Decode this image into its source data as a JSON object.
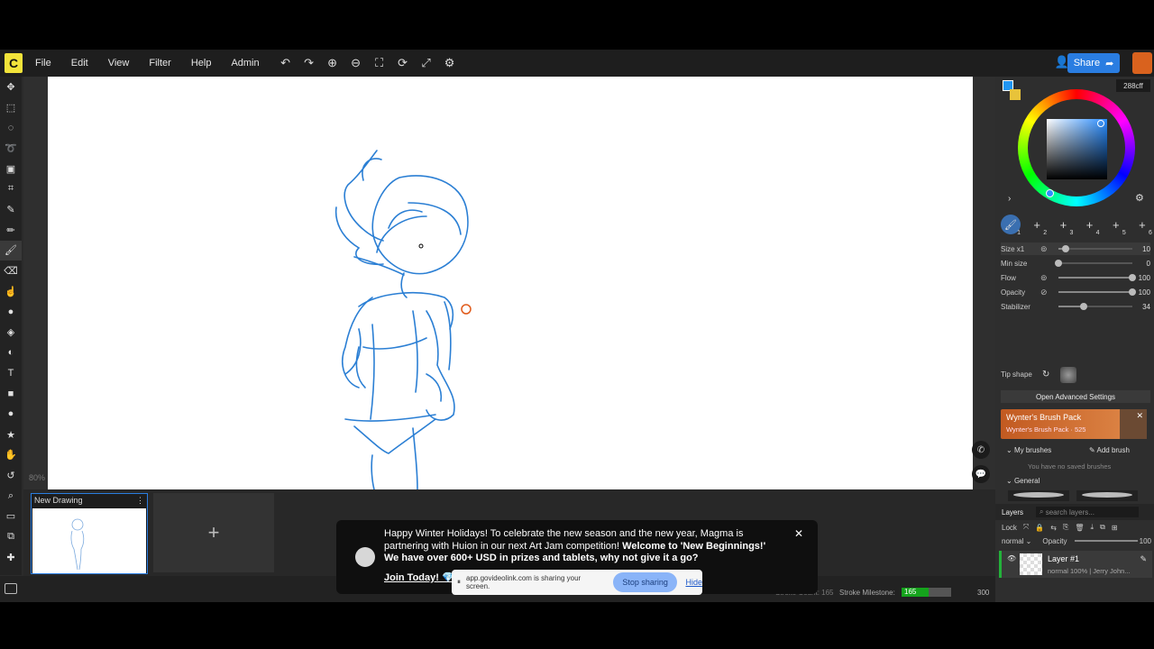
{
  "app": {
    "logo": "C"
  },
  "menu": [
    "File",
    "Edit",
    "View",
    "Filter",
    "Help",
    "Admin"
  ],
  "toolbar_icons": [
    "undo-icon",
    "redo-icon",
    "zoom-in-icon",
    "zoom-out-icon",
    "fit-icon",
    "rotate-icon",
    "fullscreen-icon",
    "settings-icon"
  ],
  "share": {
    "label": "Share"
  },
  "left_tools": [
    "move",
    "rect-select",
    "ellipse-select",
    "lasso",
    "transform",
    "crop",
    "eyedropper",
    "pencil",
    "brush",
    "eraser",
    "smudge",
    "blur",
    "fill",
    "gradient",
    "text",
    "rectangle",
    "ellipse",
    "star",
    "hand",
    "undo-history",
    "zoom",
    "comment",
    "layers",
    "add"
  ],
  "canvas": {
    "zoom": "80%"
  },
  "frames": {
    "frame_title": "New Drawing",
    "add_label": "+"
  },
  "status": {
    "stroke_count_label": "Stroke Count: 165",
    "stroke_milestone_label": "Stroke Milestone:",
    "milestone_value": "165",
    "milestone_progress": 0.55,
    "milestone_max": "300"
  },
  "color": {
    "hex": "288cff",
    "primary": "#288cff",
    "secondary": "#e8c33a"
  },
  "brush_slots": [
    {
      "label": "1",
      "active": true
    },
    {
      "label": "2"
    },
    {
      "label": "3"
    },
    {
      "label": "4"
    },
    {
      "label": "5"
    },
    {
      "label": "6"
    }
  ],
  "brush_props": {
    "size": {
      "label": "Size x1",
      "value": "10",
      "fraction": 0.1
    },
    "min_size": {
      "label": "Min size",
      "value": "0",
      "fraction": 0.0
    },
    "flow": {
      "label": "Flow",
      "value": "100",
      "fraction": 1.0
    },
    "opacity": {
      "label": "Opacity",
      "value": "100",
      "fraction": 1.0
    },
    "stabilizer": {
      "label": "Stabilizer",
      "value": "34",
      "fraction": 0.34
    }
  },
  "tip_shape_label": "Tip shape",
  "advanced_label": "Open Advanced Settings",
  "brush_pack": {
    "title": "Wynter's Brush Pack",
    "subtitle": "Wynter's Brush Pack · 525"
  },
  "my_brushes": {
    "label": "My brushes",
    "add_label": "Add brush",
    "empty_text": "You have no saved brushes"
  },
  "general_label": "General",
  "layers": {
    "title": "Layers",
    "search_placeholder": "search layers...",
    "lock_label": "Lock",
    "blend_mode": "normal",
    "opacity_label": "Opacity",
    "opacity_value": "100",
    "items": [
      {
        "name": "Layer #1",
        "meta": "normal 100% | Jerry John..."
      }
    ]
  },
  "notification": {
    "text_plain": "Happy Winter Holidays! To celebrate the new season and the new year, Magma is partnering with Huion in our next Art Jam competition!",
    "text_bold": "Welcome to 'New Beginnings!' We have over 600+ USD in prizes and tablets, why not give it a go?",
    "cta": "Join Today! 💎"
  },
  "screen_share": {
    "text": "app.govideolink.com is sharing your screen.",
    "stop_label": "Stop sharing",
    "hide_label": "Hide"
  }
}
